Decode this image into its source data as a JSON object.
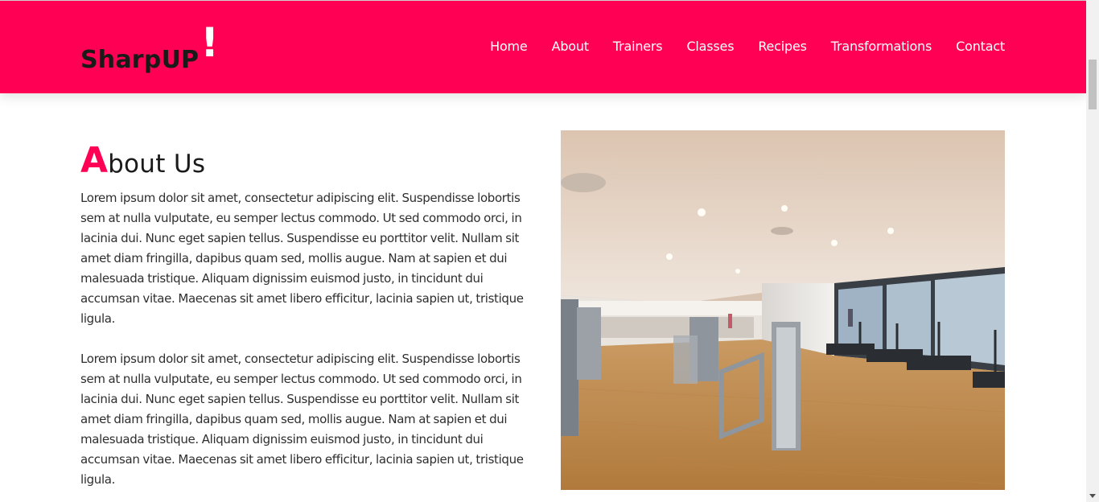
{
  "brand": {
    "name": "SharpUP",
    "mark": "!"
  },
  "nav": {
    "items": [
      {
        "label": "Home"
      },
      {
        "label": "About"
      },
      {
        "label": "Trainers"
      },
      {
        "label": "Classes"
      },
      {
        "label": "Recipes"
      },
      {
        "label": "Transformations"
      },
      {
        "label": "Contact"
      }
    ]
  },
  "about": {
    "title_initial": "A",
    "title_rest": "bout Us",
    "paragraphs": [
      "Lorem ipsum dolor sit amet, consectetur adipiscing elit. Suspendisse lobortis sem at nulla vulputate, eu semper lectus commodo. Ut sed commodo orci, in lacinia dui. Nunc eget sapien tellus. Suspendisse eu porttitor velit. Nullam sit amet diam fringilla, dapibus quam sed, mollis augue. Nam at sapien et dui malesuada tristique. Aliquam dignissim euismod justo, in tincidunt dui accumsan vitae. Maecenas sit amet libero efficitur, lacinia sapien ut, tristique ligula.",
      "Lorem ipsum dolor sit amet, consectetur adipiscing elit. Suspendisse lobortis sem at nulla vulputate, eu semper lectus commodo. Ut sed commodo orci, in lacinia dui. Nunc eget sapien tellus. Suspendisse eu porttitor velit. Nullam sit amet diam fringilla, dapibus quam sed, mollis augue. Nam at sapien et dui malesuada tristique. Aliquam dignissim euismod justo, in tincidunt dui accumsan vitae. Maecenas sit amet libero efficitur, lacinia sapien ut, tristique ligula."
    ]
  },
  "colors": {
    "accent": "#ff0054",
    "text": "#2e2e2e",
    "heading": "#1a1a1a"
  }
}
